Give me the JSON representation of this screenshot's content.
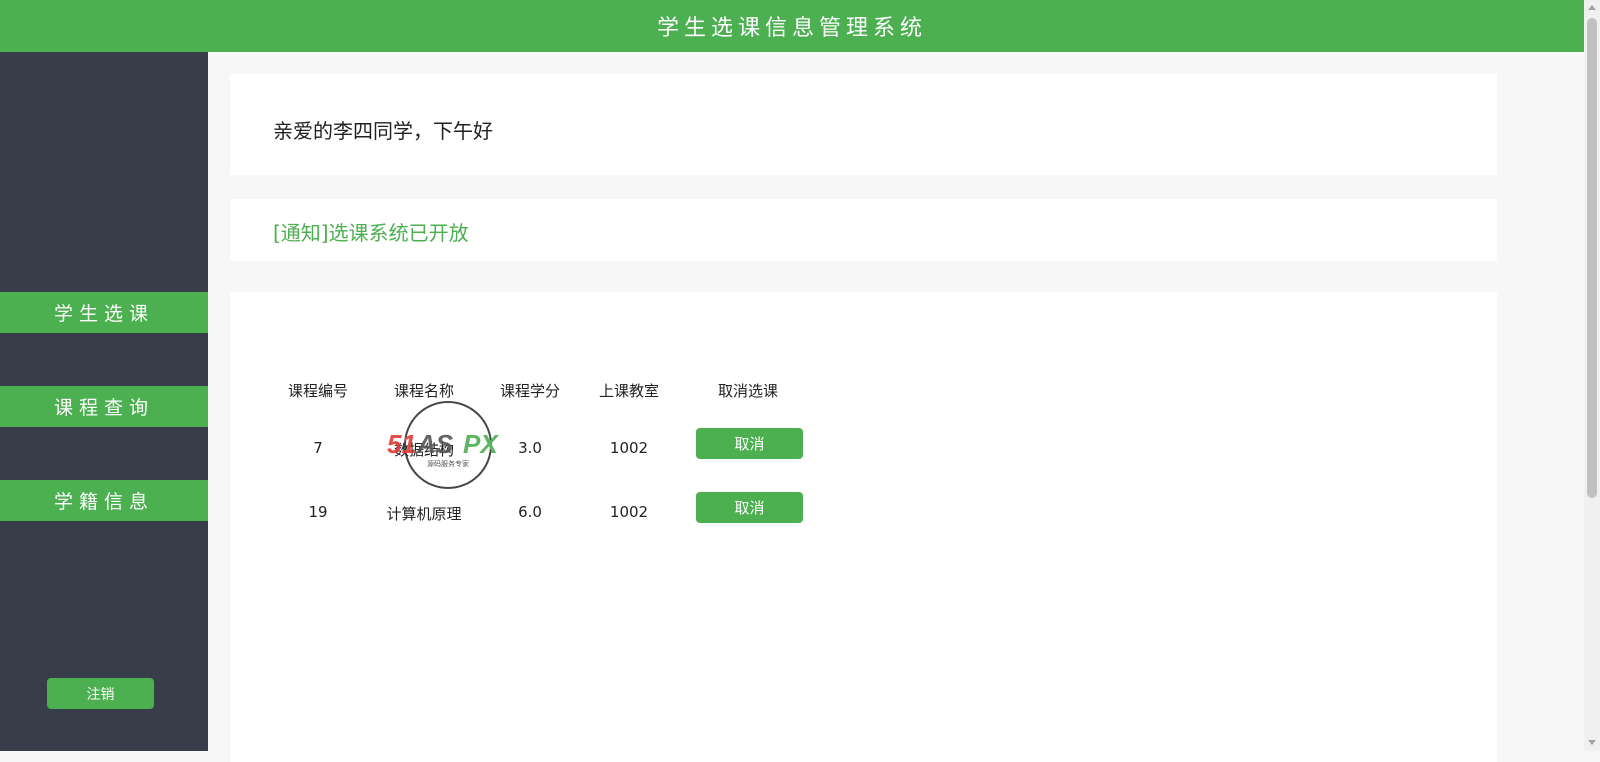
{
  "header": {
    "title": "学生选课信息管理系统"
  },
  "sidebar": {
    "items": [
      {
        "label": "学生选课"
      },
      {
        "label": "课程查询"
      },
      {
        "label": "学籍信息"
      }
    ],
    "logout_label": "注销"
  },
  "main": {
    "greeting": "亲爱的李四同学，下午好",
    "notice": "[通知]选课系统已开放",
    "table": {
      "headers": [
        "课程编号",
        "课程名称",
        "课程学分",
        "上课教室",
        "取消选课"
      ],
      "rows": [
        {
          "id": "7",
          "name": "数据结构",
          "credit": "3.0",
          "room": "1002",
          "action": "取消"
        },
        {
          "id": "19",
          "name": "计算机原理",
          "credit": "6.0",
          "room": "1002",
          "action": "取消"
        }
      ]
    },
    "watermark": {
      "brand": "51ASPX",
      "tagline": "源码服务专家"
    }
  },
  "colors": {
    "accent": "#4caf50",
    "sidebar_bg": "#373d49"
  }
}
